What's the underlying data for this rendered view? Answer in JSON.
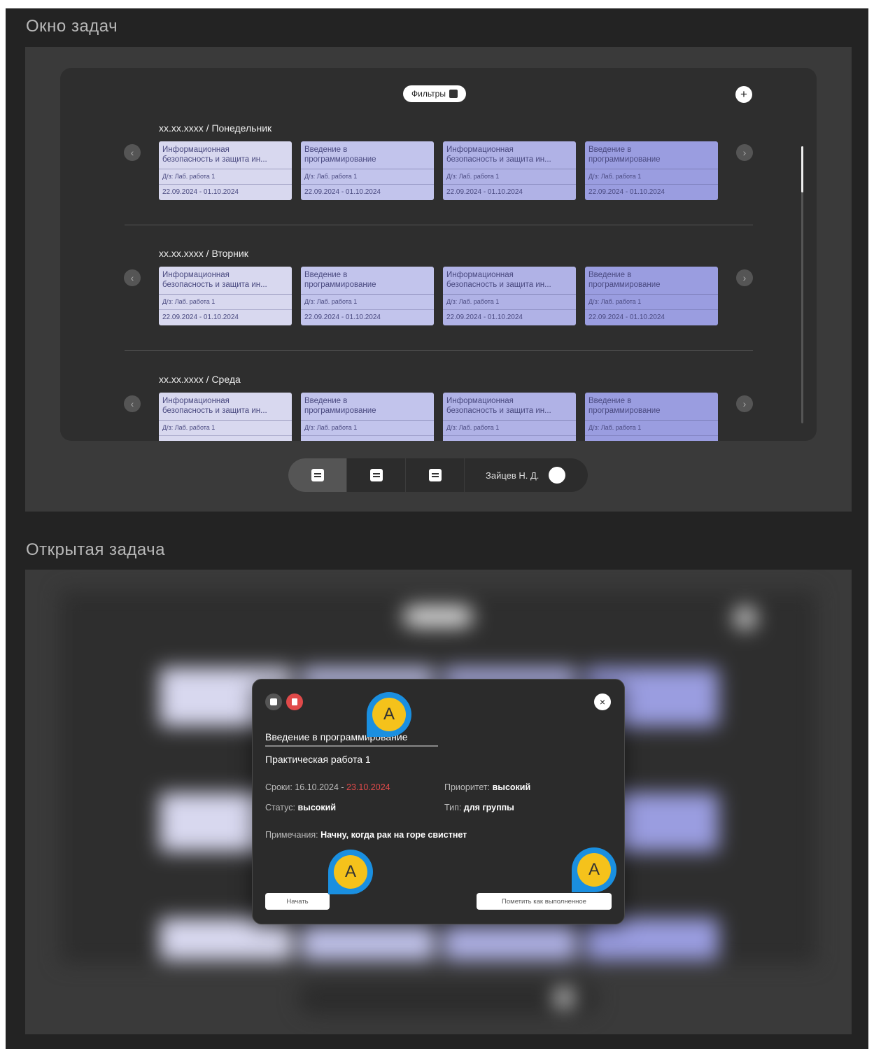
{
  "tasks_window": {
    "section_title": "Окно задач",
    "filters_label": "Фильтры",
    "add_label": "+",
    "days": [
      {
        "title": "xx.xx.xxxx / Понедельник",
        "cards": [
          {
            "title_l1": "Информационная",
            "title_l2": "безопасность и защита ин...",
            "subtitle": "Д/з: Лаб. работа 1",
            "dates": "22.09.2024 - 01.10.2024"
          },
          {
            "title_l1": "Введение в",
            "title_l2": "программирование",
            "subtitle": "Д/з: Лаб. работа 1",
            "dates": "22.09.2024 - 01.10.2024"
          },
          {
            "title_l1": "Информационная",
            "title_l2": "безопасность и защита ин...",
            "subtitle": "Д/з: Лаб. работа 1",
            "dates": "22.09.2024 - 01.10.2024"
          },
          {
            "title_l1": "Введение в",
            "title_l2": "программирование",
            "subtitle": "Д/з: Лаб. работа 1",
            "dates": "22.09.2024 - 01.10.2024"
          }
        ]
      },
      {
        "title": "xx.xx.xxxx / Вторник",
        "cards": [
          {
            "title_l1": "Информационная",
            "title_l2": "безопасность и защита ин...",
            "subtitle": "Д/з: Лаб. работа 1",
            "dates": "22.09.2024 - 01.10.2024"
          },
          {
            "title_l1": "Введение в",
            "title_l2": "программирование",
            "subtitle": "Д/з: Лаб. работа 1",
            "dates": "22.09.2024 - 01.10.2024"
          },
          {
            "title_l1": "Информационная",
            "title_l2": "безопасность и защита ин...",
            "subtitle": "Д/з: Лаб. работа 1",
            "dates": "22.09.2024 - 01.10.2024"
          },
          {
            "title_l1": "Введение в",
            "title_l2": "программирование",
            "subtitle": "Д/з: Лаб. работа 1",
            "dates": "22.09.2024 - 01.10.2024"
          }
        ]
      },
      {
        "title": "xx.xx.xxxx / Среда",
        "cards": [
          {
            "title_l1": "Информационная",
            "title_l2": "безопасность и защита ин...",
            "subtitle": "Д/з: Лаб. работа 1",
            "dates": ""
          },
          {
            "title_l1": "Введение в",
            "title_l2": "программирование",
            "subtitle": "Д/з: Лаб. работа 1",
            "dates": ""
          },
          {
            "title_l1": "Информационная",
            "title_l2": "безопасность и защита ин...",
            "subtitle": "Д/з: Лаб. работа 1",
            "dates": ""
          },
          {
            "title_l1": "Введение в",
            "title_l2": "программирование",
            "subtitle": "Д/з: Лаб. работа 1",
            "dates": ""
          }
        ]
      }
    ],
    "card_colors": [
      "#d8d8ef",
      "#c2c4ec",
      "#b0b2e6",
      "#9a9de0"
    ],
    "arrow_left": "‹",
    "arrow_right": "›",
    "nav": {
      "items": [
        "tasks-icon",
        "list-icon",
        "calendar-icon"
      ],
      "active_index": 0,
      "user_name": "Зайцев Н. Д."
    }
  },
  "open_task": {
    "section_title": "Открытая задача",
    "edit_icon": "edit-icon",
    "delete_icon": "trash-icon",
    "close_label": "×",
    "title": "Введение в программирование",
    "subtitle": "Практическая работа 1",
    "deadline_label": "Сроки:",
    "deadline_start": "16.10.2024",
    "deadline_sep": "-",
    "deadline_end": "23.10.2024",
    "priority_label": "Приоритет:",
    "priority_value": "высокий",
    "status_label": "Статус:",
    "status_value": "высокий",
    "type_label": "Тип:",
    "type_value": "для группы",
    "notes_label": "Примечания:",
    "notes_value": "Начну, когда рак на горе свистнет",
    "start_label": "Начать",
    "complete_label": "Пометить как выполненное",
    "markers": [
      "A",
      "A",
      "A"
    ]
  },
  "colors": {
    "accent_red": "#e04a4a",
    "marker_yellow": "#f5c21b",
    "marker_blue": "#1a8fe0"
  }
}
